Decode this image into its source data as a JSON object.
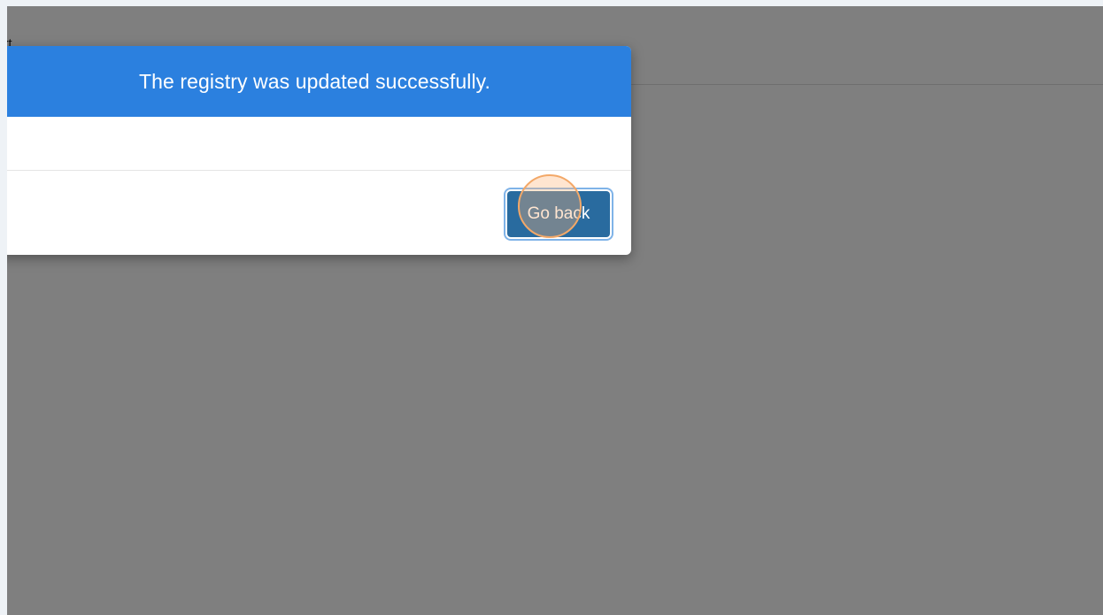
{
  "page": {
    "header_text": "ort"
  },
  "modal": {
    "title": "The registry was updated successfully.",
    "go_back_label": "Go back",
    "header_color": "#2b80df",
    "button_color": "#296b9f"
  }
}
